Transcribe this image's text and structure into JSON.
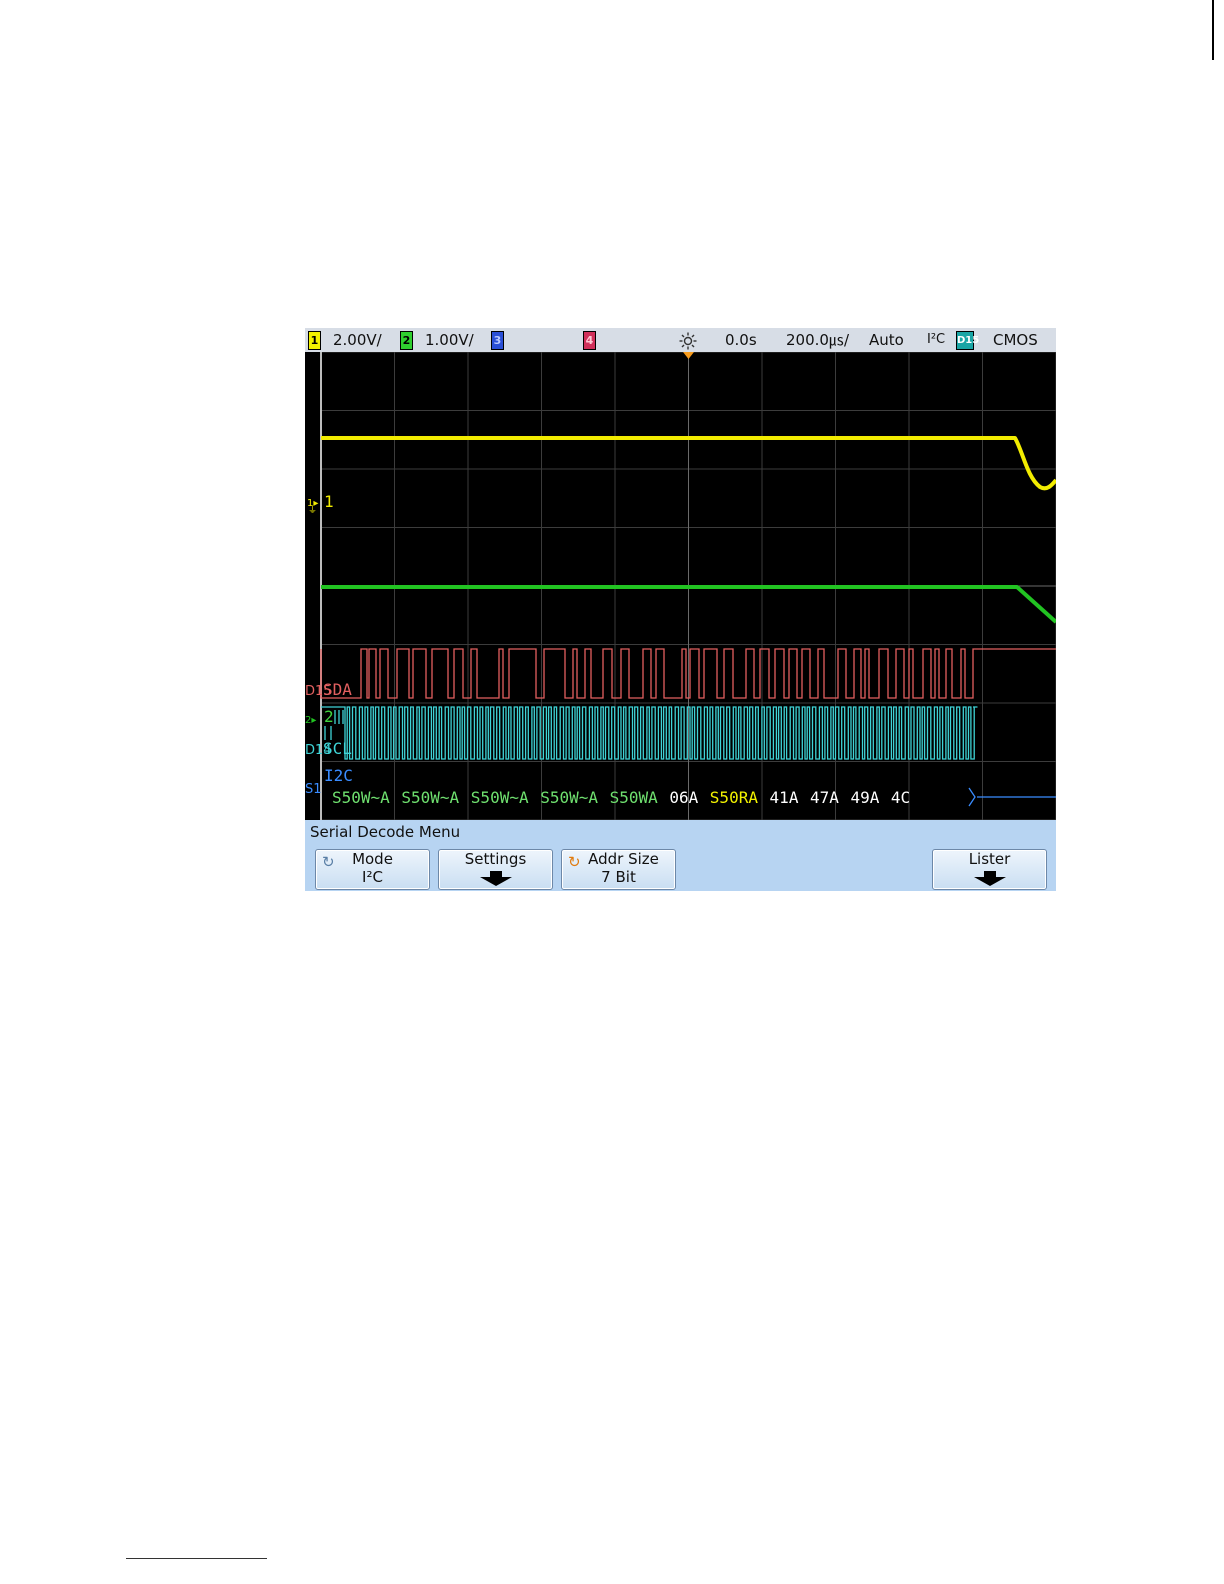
{
  "status_bar": {
    "ch1_badge": "1",
    "ch1_scale": "2.00V/",
    "ch2_badge": "2",
    "ch2_scale": "1.00V/",
    "ch3_badge": "3",
    "ch4_badge": "4",
    "time_offset": "0.0s",
    "time_scale": "200.0㎲/",
    "trigger_mode": "Auto",
    "trigger_type": "I²C",
    "digital_badge": "D15",
    "logic_family": "CMOS",
    "icon": "sun-icon"
  },
  "channel_labels": {
    "ch1": "1",
    "ch2": "2",
    "sda": "SDA",
    "scl": "SCL",
    "i2c": "I2C",
    "d15": "D15",
    "d14": "D14",
    "s1": "S1"
  },
  "decode_packets": [
    {
      "text": "S50W~A",
      "color": "#6fe06f"
    },
    {
      "text": "S50W~A",
      "color": "#6fe06f"
    },
    {
      "text": "S50W~A",
      "color": "#6fe06f"
    },
    {
      "text": "S50W~A",
      "color": "#6fe06f"
    },
    {
      "text": "S50WA",
      "color": "#6fe06f"
    },
    {
      "text": "06A",
      "color": "#ffffff"
    },
    {
      "text": "S50RA",
      "color": "#f2f200"
    },
    {
      "text": "41A",
      "color": "#ffffff"
    },
    {
      "text": "47A",
      "color": "#ffffff"
    },
    {
      "text": "49A",
      "color": "#ffffff"
    },
    {
      "text": "4C",
      "color": "#ffffff"
    }
  ],
  "colors": {
    "ch1": "#f2ec00",
    "ch2": "#22c322",
    "sda": "#e36060",
    "scl": "#3fd3d6",
    "bus": "#3a8cff",
    "grid": "#3c3c3c"
  },
  "menu": {
    "title": "Serial Decode Menu",
    "mode_label": "Mode",
    "mode_value": "I²C",
    "settings_label": "Settings",
    "addr_size_label": "Addr Size",
    "addr_size_value": "7 Bit",
    "lister_label": "Lister"
  }
}
